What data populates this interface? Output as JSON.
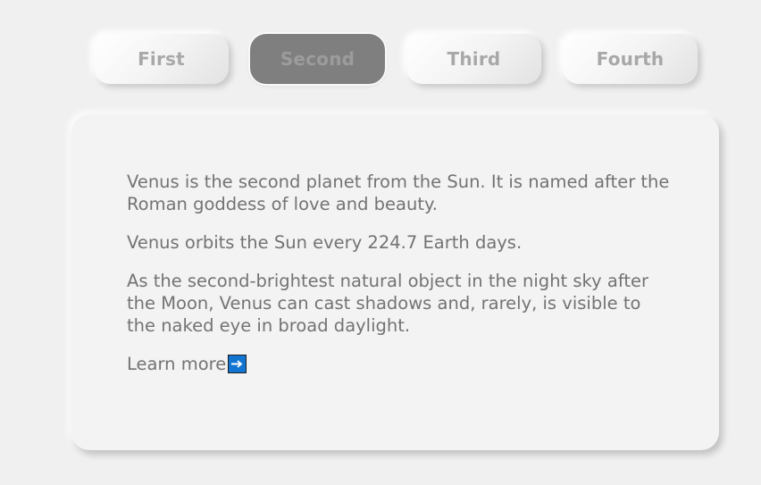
{
  "tabs": [
    {
      "label": "First",
      "active": false
    },
    {
      "label": "Second",
      "active": true
    },
    {
      "label": "Third",
      "active": false
    },
    {
      "label": "Fourth",
      "active": false
    }
  ],
  "content": {
    "paragraphs": [
      "Venus is the second planet from the Sun. It is named after the Roman goddess of love and beauty.",
      "Venus orbits the Sun every 224.7 Earth days.",
      "As the second-brightest natural object in the night sky after the Moon, Venus can cast shadows and, rarely, is visible to the naked eye in broad daylight."
    ],
    "learn_more_label": "Learn more",
    "learn_more_icon": "right-arrow-icon"
  },
  "colors": {
    "background": "#f0f0f0",
    "active_tab": "#7f7f7f",
    "text": "#737373",
    "link_icon": "#1275d2"
  }
}
